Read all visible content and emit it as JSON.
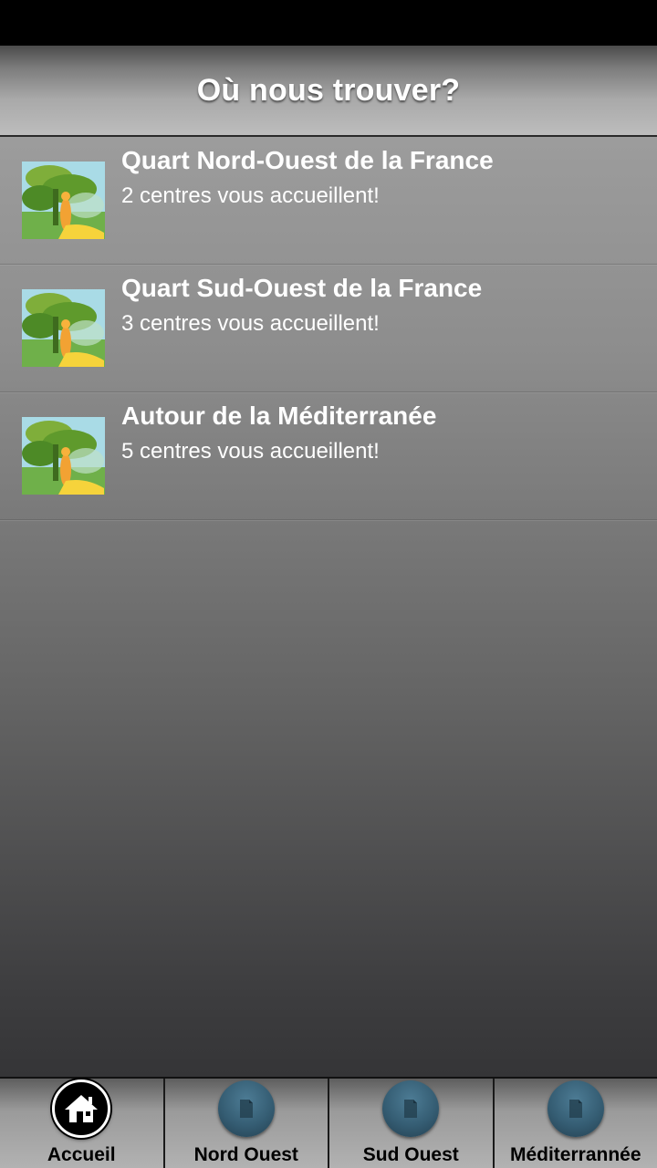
{
  "header": {
    "title": "Où nous trouver?"
  },
  "regions": [
    {
      "title": "Quart Nord-Ouest de la France",
      "subtitle": "2 centres vous accueillent!",
      "thumb_icon": "tree-figure-thumbnail"
    },
    {
      "title": "Quart Sud-Ouest de la France",
      "subtitle": "3 centres vous accueillent!",
      "thumb_icon": "tree-figure-thumbnail"
    },
    {
      "title": "Autour de la Méditerranée",
      "subtitle": "5 centres vous accueillent!",
      "thumb_icon": "tree-figure-thumbnail"
    }
  ],
  "tabs": [
    {
      "label": "Accueil",
      "icon": "home-icon",
      "active": true
    },
    {
      "label": "Nord Ouest",
      "icon": "document-icon",
      "active": false
    },
    {
      "label": "Sud Ouest",
      "icon": "document-icon",
      "active": false
    },
    {
      "label": "Méditerrannée",
      "icon": "document-icon",
      "active": false
    }
  ],
  "colors": {
    "status_bar": "#000000",
    "tab_icon_blue": "#355d73",
    "text": "#ffffff"
  }
}
